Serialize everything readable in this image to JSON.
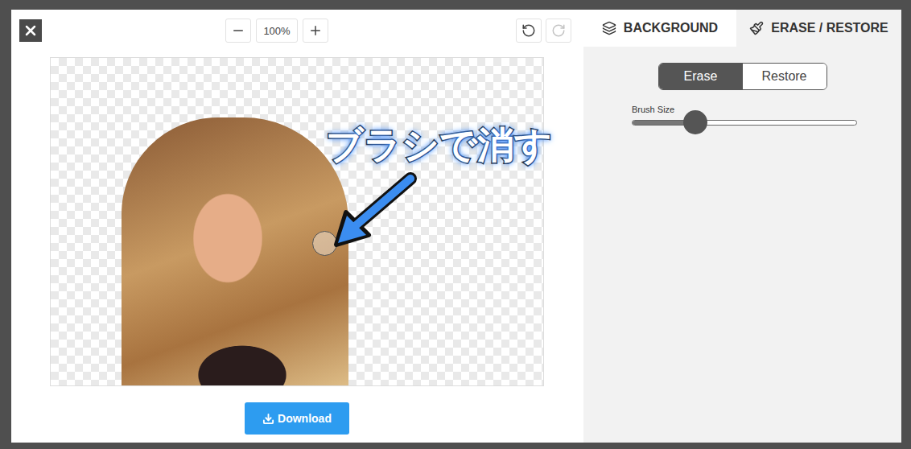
{
  "toolbar": {
    "zoom": "100%",
    "undo": {
      "disabled": false
    },
    "redo": {
      "disabled": true
    }
  },
  "canvas": {
    "annotation": "ブラシで消す"
  },
  "download": {
    "label": "Download"
  },
  "tabs": [
    {
      "label": "BACKGROUND",
      "selected": false
    },
    {
      "label": "ERASE / RESTORE",
      "selected": true
    }
  ],
  "modes": [
    {
      "label": "Erase",
      "selected": true
    },
    {
      "label": "Restore",
      "selected": false
    }
  ],
  "brush": {
    "label": "Brush Size",
    "level": 0.28
  }
}
